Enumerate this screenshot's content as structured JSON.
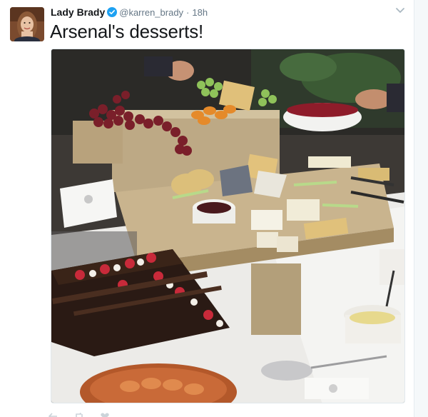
{
  "tweet": {
    "display_name": "Lady Brady",
    "handle": "@karren_brady",
    "separator": "·",
    "time": "18h",
    "text": "Arsenal's desserts!"
  },
  "icons": {
    "verified": "verified-badge-icon",
    "more": "chevron-down-icon",
    "reply": "reply-icon",
    "retweet": "retweet-icon",
    "like": "heart-icon"
  },
  "colors": {
    "verified": "#1da1f2",
    "text": "#14171a",
    "muted": "#657786"
  },
  "actions": {
    "reply_count": "",
    "retweet_count": "",
    "like_count": ""
  }
}
